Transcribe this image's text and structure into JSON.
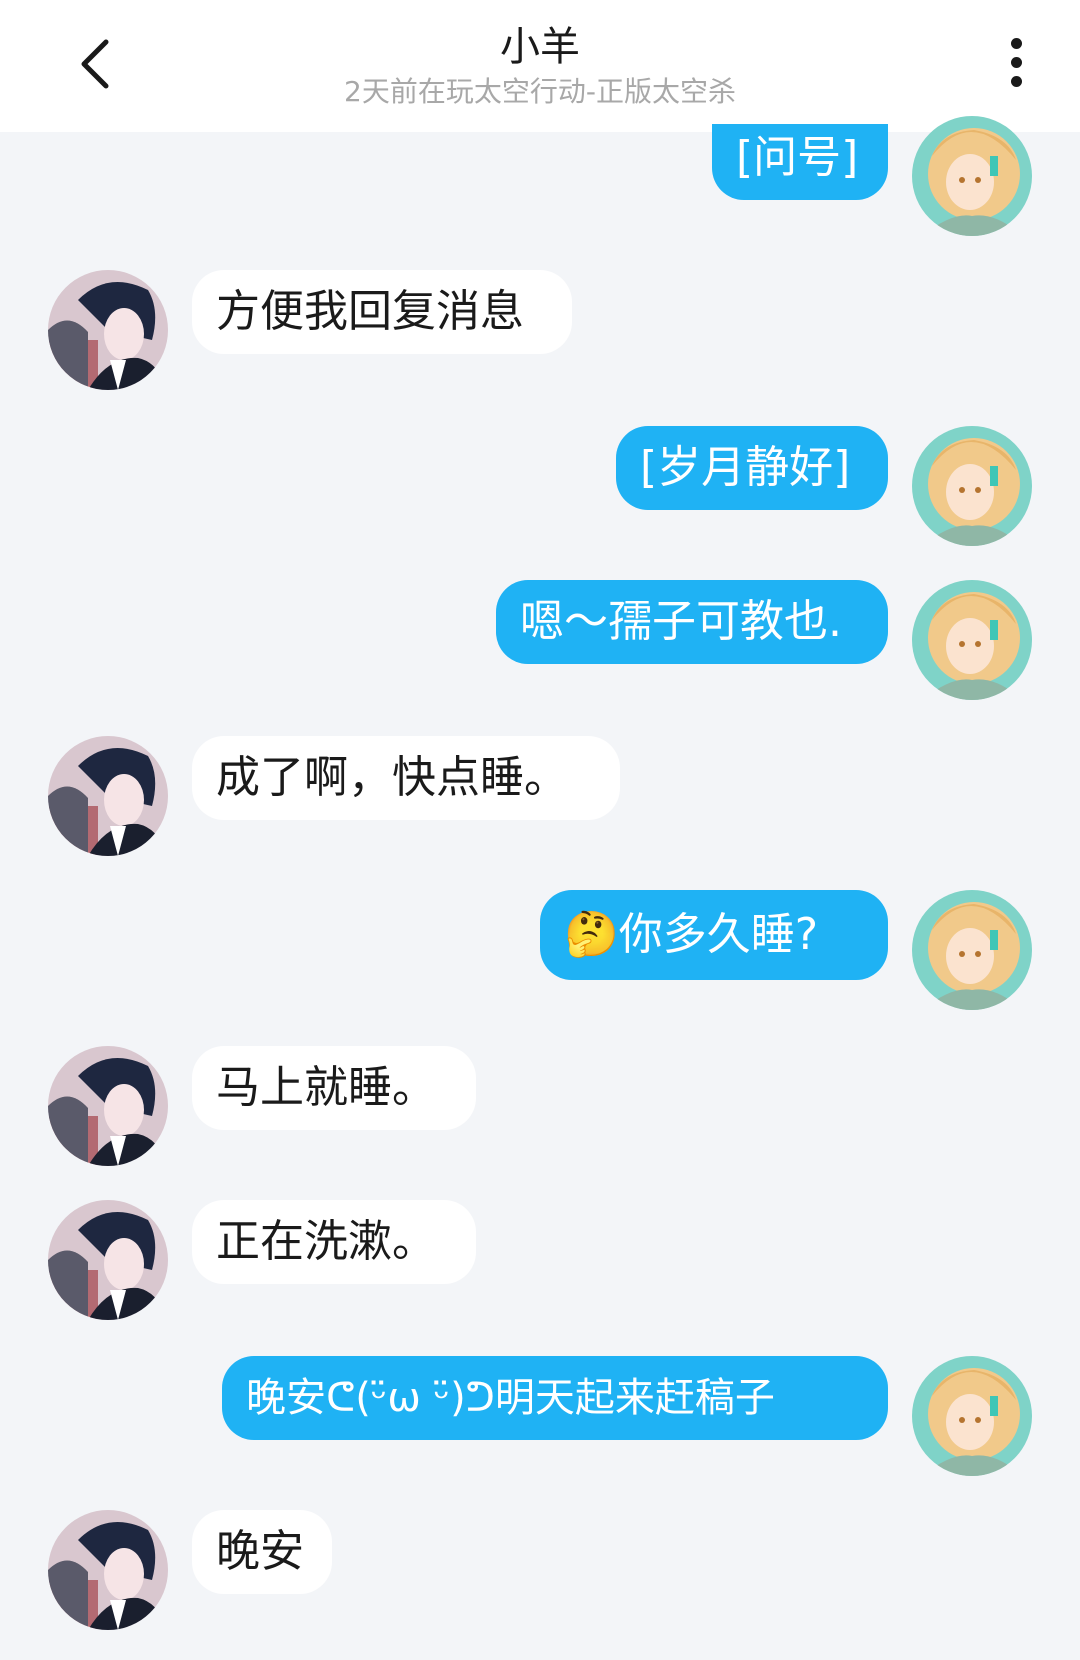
{
  "header": {
    "title": "小羊",
    "subtitle": "2天前在玩太空行动-正版太空杀",
    "back_icon": "chevron-left-icon",
    "more_icon": "vertical-dots-icon"
  },
  "colors": {
    "outgoing_bubble": "#1fb2f4",
    "incoming_bubble": "#ffffff",
    "background": "#f3f5f8"
  },
  "messages": [
    {
      "side": "out",
      "text": "[问号]"
    },
    {
      "side": "in",
      "text": "方便我回复消息"
    },
    {
      "side": "out",
      "text": "[岁月静好]"
    },
    {
      "side": "out",
      "text": "嗯～孺子可教也."
    },
    {
      "side": "in",
      "text": "成了啊，快点睡。"
    },
    {
      "side": "out",
      "emoji": "🤔",
      "text": "你多久睡?"
    },
    {
      "side": "in",
      "text": "马上就睡。"
    },
    {
      "side": "in",
      "text": "正在洗漱。"
    },
    {
      "side": "out",
      "text": "晚安ᕦ(ᵕ̈ω ᵕ̈)ᕤ明天起来赶稿子"
    },
    {
      "side": "in",
      "text": "晚安"
    }
  ]
}
